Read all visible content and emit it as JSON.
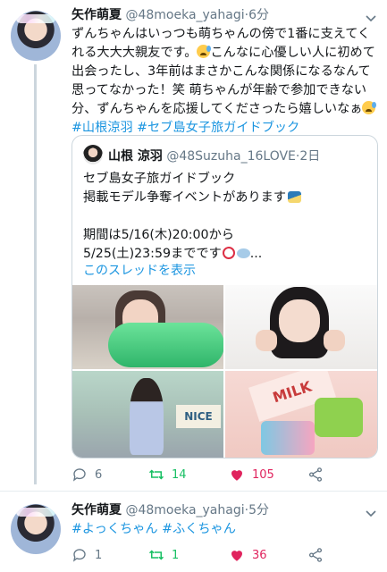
{
  "tweets": [
    {
      "name": "矢作萌夏",
      "handle": "@48moeka_yahagi",
      "time": "6分",
      "text_parts": {
        "p1": "ずんちゃんはいっつも萌ちゃんの傍で1番に支えてくれる大大大親友です。",
        "p2": "こんなに心優しい人に初めて出会ったし、3年前はまさかこんな関係になるなんて思ってなかった！笑 萌ちゃんが年齢で参加できない分、ずんちゃんを応援してくださったら嬉しいなぁ",
        "hashtag1": "#山根涼羽",
        "hashtag2": "#セブ島女子旅ガイドブック"
      },
      "quote": {
        "name": "山根 涼羽",
        "handle": "@48Suzuha_16LOVE",
        "time": "2日",
        "line1": "セブ島女子旅ガイドブック",
        "line2": "掲載モデル争奪イベントがあります",
        "line3": "期間は5/16(木)20:00から",
        "line4": "5/25(土)23:59までです",
        "line4_suffix": "...",
        "show_thread": "このスレッドを表示",
        "photo_text_sign": "NICE",
        "photo_text_milk": "MILK"
      },
      "actions": {
        "replies": "6",
        "retweets": "14",
        "likes": "105"
      }
    },
    {
      "name": "矢作萌夏",
      "handle": "@48moeka_yahagi",
      "time": "5分",
      "hashtag1": "#よっくちゃん",
      "hashtag2": "#ふくちゃん",
      "actions": {
        "replies": "1",
        "retweets": "1",
        "likes": "36"
      }
    }
  ],
  "colors": {
    "link": "#1b95e0",
    "retweet": "#17bf63",
    "like": "#e0245e",
    "muted": "#657786"
  },
  "icons": [
    "reply-icon",
    "retweet-icon",
    "heart-icon",
    "share-icon",
    "chevron-down-icon"
  ]
}
